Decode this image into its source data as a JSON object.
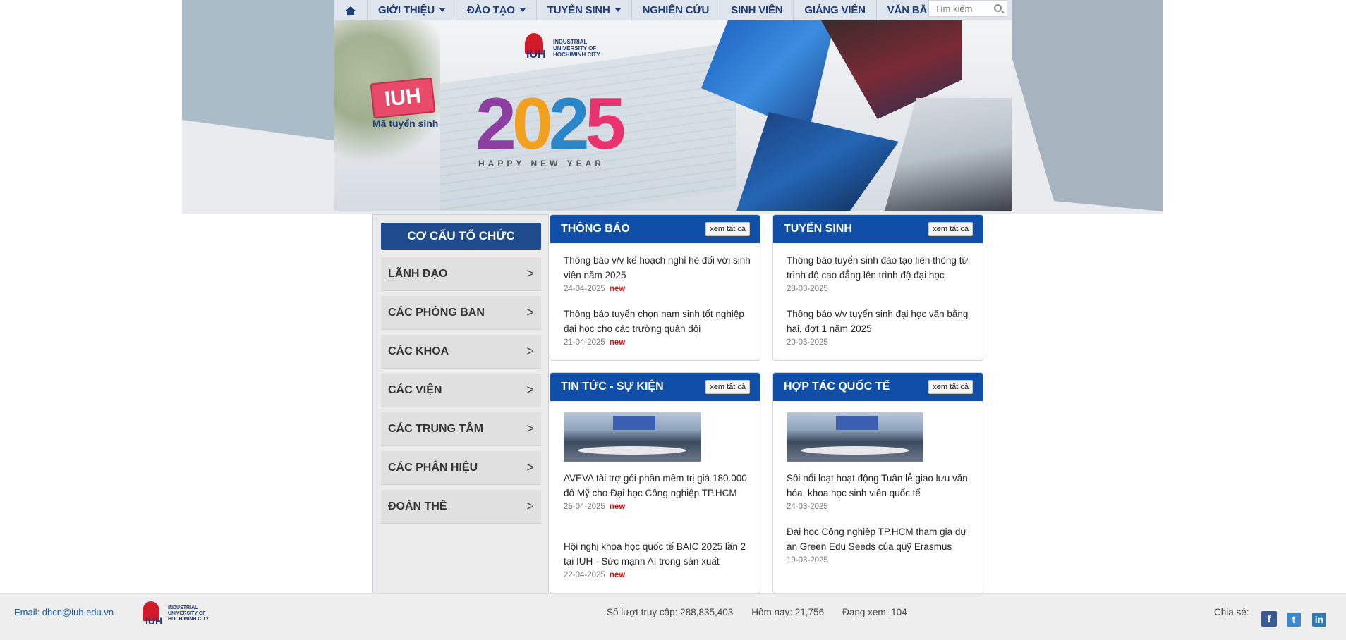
{
  "nav": {
    "items": [
      {
        "label": "GIỚI THIỆU",
        "has_caret": true
      },
      {
        "label": "ĐÀO TẠO",
        "has_caret": true
      },
      {
        "label": "TUYỂN SINH",
        "has_caret": true
      },
      {
        "label": "NGHIÊN CỨU",
        "has_caret": false
      },
      {
        "label": "SINH VIÊN",
        "has_caret": false
      },
      {
        "label": "GIẢNG VIÊN",
        "has_caret": false
      },
      {
        "label": "VĂN BẰNG",
        "has_caret": false
      }
    ],
    "search_placeholder": "Tìm kiếm"
  },
  "banner": {
    "sign_text": "IUH",
    "sign_sub": "Mã tuyển sinh",
    "logo_text_1": "INDUSTRIAL",
    "logo_text_2": "UNIVERSITY OF",
    "logo_text_3": "HOCHIMINH CITY",
    "year": [
      "2",
      "0",
      "2",
      "5"
    ],
    "greeting": "HAPPY NEW YEAR"
  },
  "sidebar": {
    "title": "CƠ CẤU TỔ CHỨC",
    "arrow": ">",
    "items": [
      {
        "label": "LÃNH ĐẠO"
      },
      {
        "label": "CÁC PHÒNG BAN"
      },
      {
        "label": "CÁC KHOA"
      },
      {
        "label": "CÁC VIỆN"
      },
      {
        "label": "CÁC TRUNG TÂM"
      },
      {
        "label": "CÁC PHÂN HIỆU"
      },
      {
        "label": "ĐOÀN THỂ"
      }
    ]
  },
  "panels": {
    "see_all": "xem tất cả",
    "new_label": "new",
    "thong_bao": {
      "title": "THÔNG BÁO",
      "posts": [
        {
          "title": "Thông báo v/v kế hoạch nghỉ hè đối với sinh viên năm 2025",
          "date": "24-04-2025",
          "is_new": true
        },
        {
          "title": "Thông báo tuyển chọn nam sinh tốt nghiệp đại học cho các trường quân đội",
          "date": "21-04-2025",
          "is_new": true
        }
      ]
    },
    "tuyen_sinh": {
      "title": "TUYỂN SINH",
      "posts": [
        {
          "title": "Thông báo tuyển sinh đào tạo liên thông từ trình độ cao đẳng lên trình độ đại học",
          "date": "28-03-2025",
          "is_new": false
        },
        {
          "title": "Thông báo v/v tuyển sinh đại học văn bằng hai, đợt 1 năm 2025",
          "date": "20-03-2025",
          "is_new": false
        }
      ]
    },
    "tin_tuc": {
      "title": "TIN TỨC - SỰ KIỆN",
      "posts": [
        {
          "title": "AVEVA tài trợ gói phần mềm trị giá 180.000 đô Mỹ cho Đại học Công nghiệp TP.HCM",
          "date": "25-04-2025",
          "is_new": true
        },
        {
          "title": "Hội nghị khoa học quốc tế BAIC 2025 lần 2 tại IUH - Sức mạnh AI trong sản xuất",
          "date": "22-04-2025",
          "is_new": true
        }
      ]
    },
    "hop_tac": {
      "title": "HỢP TÁC QUỐC TẾ",
      "posts": [
        {
          "title": "Sôi nổi loạt hoạt động Tuần lễ giao lưu văn hóa, khoa học sinh viên quốc tế",
          "date": "24-03-2025",
          "is_new": false
        },
        {
          "title": "Đại học Công nghiệp TP.HCM tham gia dự án Green Edu Seeds của quỹ Erasmus",
          "date": "19-03-2025",
          "is_new": false
        }
      ]
    }
  },
  "footer": {
    "email": "Email: dhcn@iuh.edu.vn",
    "logo_text_1": "INDUSTRIAL",
    "logo_text_2": "UNIVERSITY OF",
    "logo_text_3": "HOCHIMINH CITY",
    "visits": "Số lượt truy cập: 288,835,403",
    "today": "Hôm nay: 21,756",
    "viewing": "Đang xem: 104",
    "share_label": "Chia sẻ:",
    "social": {
      "facebook": "f",
      "twitter": "t",
      "linkedin": "in"
    }
  },
  "colors": {
    "nav_text": "#1f3d7a",
    "panel_header": "#0f4fa8",
    "sidebar_title": "#1f4b8c",
    "new_badge": "#d01818"
  }
}
